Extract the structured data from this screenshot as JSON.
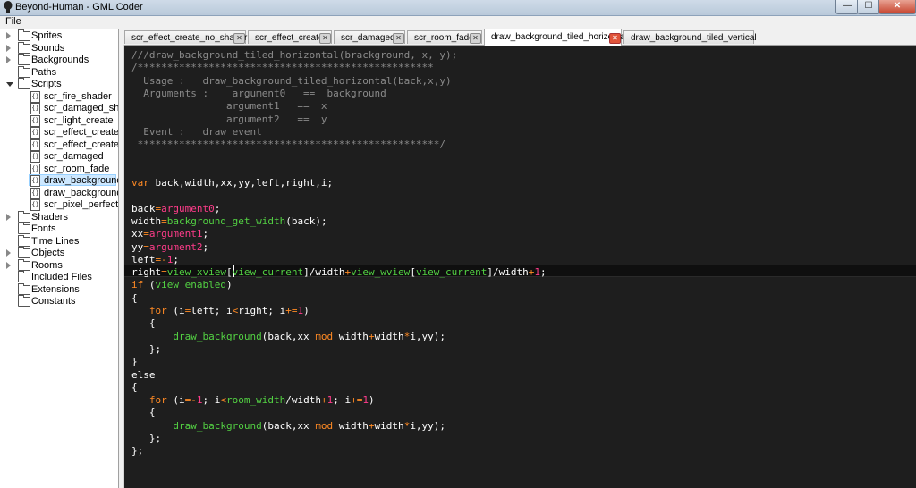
{
  "window": {
    "title": "Beyond-Human - GML Coder",
    "minimize": "—",
    "maximize": "☐",
    "close": "✕"
  },
  "menu": {
    "file": "File"
  },
  "colors": {
    "comment": "#8a8a8a",
    "keyword": "#ff8a24",
    "builtin": "#53d143",
    "variable": "#ff3c8a",
    "number": "#ff3c8a",
    "text": "#ffffff"
  },
  "sidebar": {
    "items": [
      {
        "label": "Sprites",
        "icon": "folder-icon",
        "arrow": "collapsed"
      },
      {
        "label": "Sounds",
        "icon": "folder-icon",
        "arrow": "collapsed"
      },
      {
        "label": "Backgrounds",
        "icon": "folder-icon",
        "arrow": "collapsed"
      },
      {
        "label": "Paths",
        "icon": "folder-icon",
        "arrow": "none"
      },
      {
        "label": "Scripts",
        "icon": "folder-icon",
        "arrow": "expanded"
      },
      {
        "label": "scr_fire_shader",
        "icon": "script-icon"
      },
      {
        "label": "scr_damaged_sha...",
        "icon": "script-icon"
      },
      {
        "label": "scr_light_create",
        "icon": "script-icon"
      },
      {
        "label": "scr_effect_create",
        "icon": "script-icon"
      },
      {
        "label": "scr_effect_create_...",
        "icon": "script-icon"
      },
      {
        "label": "scr_damaged",
        "icon": "script-icon"
      },
      {
        "label": "scr_room_fade",
        "icon": "script-icon"
      },
      {
        "label": "draw_background...",
        "icon": "script-icon",
        "selected": true
      },
      {
        "label": "draw_background...",
        "icon": "script-icon"
      },
      {
        "label": "scr_pixel_perfect_c...",
        "icon": "script-icon"
      },
      {
        "label": "Shaders",
        "icon": "folder-icon",
        "arrow": "collapsed"
      },
      {
        "label": "Fonts",
        "icon": "folder-icon",
        "arrow": "none"
      },
      {
        "label": "Time Lines",
        "icon": "folder-icon",
        "arrow": "none"
      },
      {
        "label": "Objects",
        "icon": "folder-icon",
        "arrow": "collapsed"
      },
      {
        "label": "Rooms",
        "icon": "folder-icon",
        "arrow": "collapsed"
      },
      {
        "label": "Included Files",
        "icon": "folder-icon",
        "arrow": "none"
      },
      {
        "label": "Extensions",
        "icon": "folder-icon",
        "arrow": "none"
      },
      {
        "label": "Constants",
        "icon": "folder-icon",
        "arrow": "none"
      }
    ]
  },
  "tabs": [
    {
      "label": "scr_effect_create_no_shader",
      "active": false
    },
    {
      "label": "scr_effect_create",
      "active": false
    },
    {
      "label": "scr_damaged",
      "active": false
    },
    {
      "label": "scr_room_fade",
      "active": false
    },
    {
      "label": "draw_background_tiled_horizontal",
      "active": true
    },
    {
      "label": "draw_background_tiled_vertical",
      "active": false
    }
  ],
  "code_lines": [
    [
      [
        "c",
        "///draw_background_tiled_horizontal(brackground, x, y);"
      ]
    ],
    [
      [
        "c",
        "/**************************************************"
      ]
    ],
    [
      [
        "c",
        "  Usage :   draw_background_tiled_horizontal(back,x,y)"
      ]
    ],
    [
      [
        "c",
        "  Arguments :    argument0   ==  background"
      ]
    ],
    [
      [
        "c",
        "                argument1   ==  x"
      ]
    ],
    [
      [
        "c",
        "                argument2   ==  y"
      ]
    ],
    [
      [
        "c",
        "  Event :   draw event"
      ]
    ],
    [
      [
        "c",
        " ***************************************************/"
      ]
    ],
    [],
    [],
    [
      [
        "k",
        "var "
      ],
      [
        "t",
        "back,width,xx,yy,left,right,i;"
      ]
    ],
    [],
    [
      [
        "t",
        "back"
      ],
      [
        "p",
        "="
      ],
      [
        "v",
        "argument0"
      ],
      [
        "t",
        ";"
      ]
    ],
    [
      [
        "t",
        "width"
      ],
      [
        "p",
        "="
      ],
      [
        "b",
        "background_get_width"
      ],
      [
        "t",
        "(back);"
      ]
    ],
    [
      [
        "t",
        "xx"
      ],
      [
        "p",
        "="
      ],
      [
        "v",
        "argument1"
      ],
      [
        "t",
        ";"
      ]
    ],
    [
      [
        "t",
        "yy"
      ],
      [
        "p",
        "="
      ],
      [
        "v",
        "argument2"
      ],
      [
        "t",
        ";"
      ]
    ],
    [
      [
        "t",
        "left"
      ],
      [
        "p",
        "=-"
      ],
      [
        "n",
        "1"
      ],
      [
        "t",
        ";"
      ]
    ],
    [
      [
        "t",
        "right"
      ],
      [
        "p",
        "="
      ],
      [
        "b",
        "view_xview"
      ],
      [
        "t",
        "["
      ],
      [
        "b",
        "view_current"
      ],
      [
        "t",
        "]/width"
      ],
      [
        "p",
        "+"
      ],
      [
        "b",
        "view_wview"
      ],
      [
        "t",
        "["
      ],
      [
        "b",
        "view_current"
      ],
      [
        "t",
        "]/width"
      ],
      [
        "p",
        "+"
      ],
      [
        "n",
        "1"
      ],
      [
        "t",
        ";"
      ]
    ],
    [
      [
        "k",
        "if"
      ],
      [
        "t",
        " ("
      ],
      [
        "b",
        "view_enabled"
      ],
      [
        "t",
        ")"
      ]
    ],
    [
      [
        "t",
        "{"
      ]
    ],
    [
      [
        "t",
        "   "
      ],
      [
        "k",
        "for"
      ],
      [
        "t",
        " (i"
      ],
      [
        "p",
        "="
      ],
      [
        "t",
        "left; i"
      ],
      [
        "p",
        "<"
      ],
      [
        "t",
        "right; i"
      ],
      [
        "p",
        "+="
      ],
      [
        "n",
        "1"
      ],
      [
        "t",
        ")"
      ]
    ],
    [
      [
        "t",
        "   {"
      ]
    ],
    [
      [
        "t",
        "       "
      ],
      [
        "b",
        "draw_background"
      ],
      [
        "t",
        "(back,xx "
      ],
      [
        "k",
        "mod"
      ],
      [
        "t",
        " width"
      ],
      [
        "p",
        "+"
      ],
      [
        "t",
        "width"
      ],
      [
        "p",
        "*"
      ],
      [
        "t",
        "i,yy);"
      ]
    ],
    [
      [
        "t",
        "   };"
      ]
    ],
    [
      [
        "t",
        "}"
      ]
    ],
    [
      [
        "t",
        "else"
      ]
    ],
    [
      [
        "t",
        "{"
      ]
    ],
    [
      [
        "t",
        "   "
      ],
      [
        "k",
        "for"
      ],
      [
        "t",
        " (i"
      ],
      [
        "p",
        "=-"
      ],
      [
        "n",
        "1"
      ],
      [
        "t",
        "; i"
      ],
      [
        "p",
        "<"
      ],
      [
        "b",
        "room_width"
      ],
      [
        "t",
        "/width"
      ],
      [
        "p",
        "+"
      ],
      [
        "n",
        "1"
      ],
      [
        "t",
        "; i"
      ],
      [
        "p",
        "+="
      ],
      [
        "n",
        "1"
      ],
      [
        "t",
        ")"
      ]
    ],
    [
      [
        "t",
        "   {"
      ]
    ],
    [
      [
        "t",
        "       "
      ],
      [
        "b",
        "draw_background"
      ],
      [
        "t",
        "(back,xx "
      ],
      [
        "k",
        "mod"
      ],
      [
        "t",
        " width"
      ],
      [
        "p",
        "+"
      ],
      [
        "t",
        "width"
      ],
      [
        "p",
        "*"
      ],
      [
        "t",
        "i,yy);"
      ]
    ],
    [
      [
        "t",
        "   };"
      ]
    ],
    [
      [
        "t",
        "};"
      ]
    ]
  ]
}
